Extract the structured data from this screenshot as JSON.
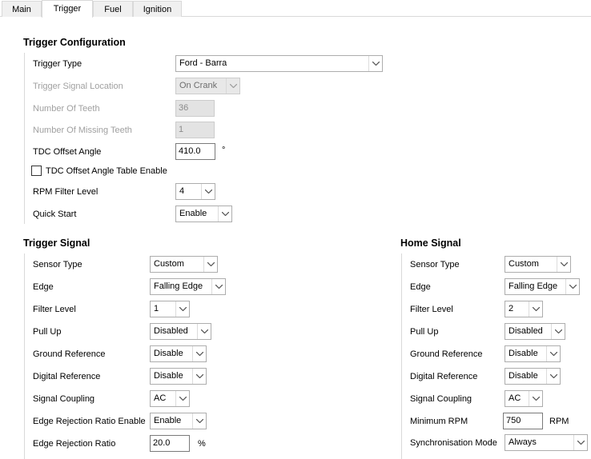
{
  "tabs": [
    {
      "label": "Main"
    },
    {
      "label": "Trigger"
    },
    {
      "label": "Fuel"
    },
    {
      "label": "Ignition"
    }
  ],
  "config": {
    "title": "Trigger Configuration",
    "trigger_type": {
      "label": "Trigger Type",
      "value": "Ford - Barra"
    },
    "signal_location": {
      "label": "Trigger Signal Location",
      "value": "On Crank"
    },
    "teeth": {
      "label": "Number Of Teeth",
      "value": "36"
    },
    "missing_teeth": {
      "label": "Number Of Missing Teeth",
      "value": "1"
    },
    "tdc_offset": {
      "label": "TDC Offset Angle",
      "value": "410.0",
      "unit": "°"
    },
    "tdc_table_enable": {
      "label": "TDC Offset Angle Table Enable",
      "checked": false
    },
    "rpm_filter": {
      "label": "RPM Filter Level",
      "value": "4"
    },
    "quick_start": {
      "label": "Quick Start",
      "value": "Enable"
    }
  },
  "trigger_signal": {
    "title": "Trigger Signal",
    "sensor_type": {
      "label": "Sensor Type",
      "value": "Custom"
    },
    "edge": {
      "label": "Edge",
      "value": "Falling Edge"
    },
    "filter_level": {
      "label": "Filter Level",
      "value": "1"
    },
    "pull_up": {
      "label": "Pull Up",
      "value": "Disabled"
    },
    "ground_ref": {
      "label": "Ground Reference",
      "value": "Disable"
    },
    "digital_ref": {
      "label": "Digital Reference",
      "value": "Disable"
    },
    "coupling": {
      "label": "Signal Coupling",
      "value": "AC"
    },
    "edge_rej_enable": {
      "label": "Edge Rejection Ratio Enable",
      "value": "Enable"
    },
    "edge_rej_ratio": {
      "label": "Edge Rejection Ratio",
      "value": "20.0",
      "unit": "%"
    }
  },
  "home_signal": {
    "title": "Home Signal",
    "sensor_type": {
      "label": "Sensor Type",
      "value": "Custom"
    },
    "edge": {
      "label": "Edge",
      "value": "Falling Edge"
    },
    "filter_level": {
      "label": "Filter Level",
      "value": "2"
    },
    "pull_up": {
      "label": "Pull Up",
      "value": "Disabled"
    },
    "ground_ref": {
      "label": "Ground Reference",
      "value": "Disable"
    },
    "digital_ref": {
      "label": "Digital Reference",
      "value": "Disable"
    },
    "coupling": {
      "label": "Signal Coupling",
      "value": "AC"
    },
    "min_rpm": {
      "label": "Minimum RPM",
      "value": "750",
      "unit": "RPM"
    },
    "sync_mode": {
      "label": "Synchronisation Mode",
      "value": "Always"
    }
  }
}
